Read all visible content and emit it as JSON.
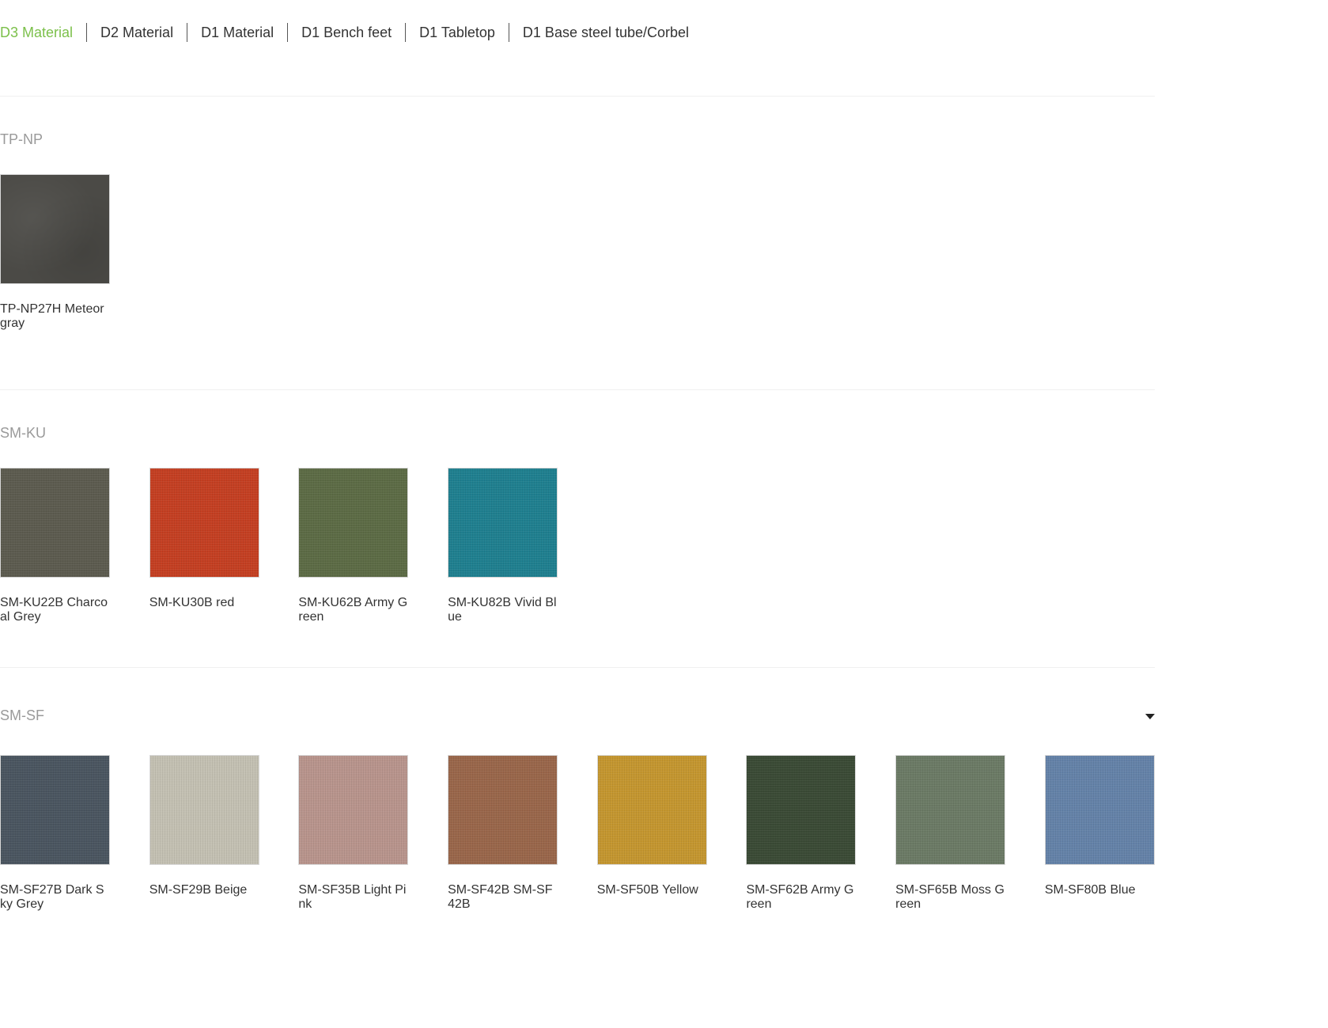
{
  "tabs": [
    {
      "label": "D3 Material",
      "active": true
    },
    {
      "label": "D2 Material",
      "active": false
    },
    {
      "label": "D1 Material",
      "active": false
    },
    {
      "label": "D1 Bench feet",
      "active": false
    },
    {
      "label": "D1 Tabletop",
      "active": false
    },
    {
      "label": "D1 Base steel tube/Corbel",
      "active": false
    }
  ],
  "sections": [
    {
      "title": "TP-NP",
      "swatches": [
        {
          "label": "TP-NP27H Meteor gray",
          "color": "#4b4a46",
          "texture": "leather"
        }
      ]
    },
    {
      "title": "SM-KU",
      "swatches": [
        {
          "label": "SM-KU22B Charcoal Grey",
          "color": "#5c5b4f",
          "texture": "fabric"
        },
        {
          "label": "SM-KU30B red",
          "color": "#c43f22",
          "texture": "fabric"
        },
        {
          "label": "SM-KU62B Army Green",
          "color": "#5c6b45",
          "texture": "fabric"
        },
        {
          "label": "SM-KU82B Vivid Blue",
          "color": "#1f7f8f",
          "texture": "fabric"
        }
      ]
    },
    {
      "title": "SM-SF",
      "has_dropdown": true,
      "swatches": [
        {
          "label": "SM-SF27B Dark Sky Grey",
          "color": "#4a5560",
          "texture": "fabric"
        },
        {
          "label": "SM-SF29B Beige",
          "color": "#c3c0b2",
          "texture": "fabric"
        },
        {
          "label": "SM-SF35B Light Pink",
          "color": "#b8948c",
          "texture": "fabric"
        },
        {
          "label": "SM-SF42B SM-SF42B",
          "color": "#99664a",
          "texture": "fabric"
        },
        {
          "label": "SM-SF50B Yellow",
          "color": "#c4962f",
          "texture": "fabric"
        },
        {
          "label": "SM-SF62B Army Green",
          "color": "#3a4a35",
          "texture": "fabric"
        },
        {
          "label": "SM-SF65B Moss Green",
          "color": "#6b7a65",
          "texture": "fabric"
        },
        {
          "label": "SM-SF80B Blue",
          "color": "#6482a8",
          "texture": "fabric"
        }
      ]
    }
  ]
}
